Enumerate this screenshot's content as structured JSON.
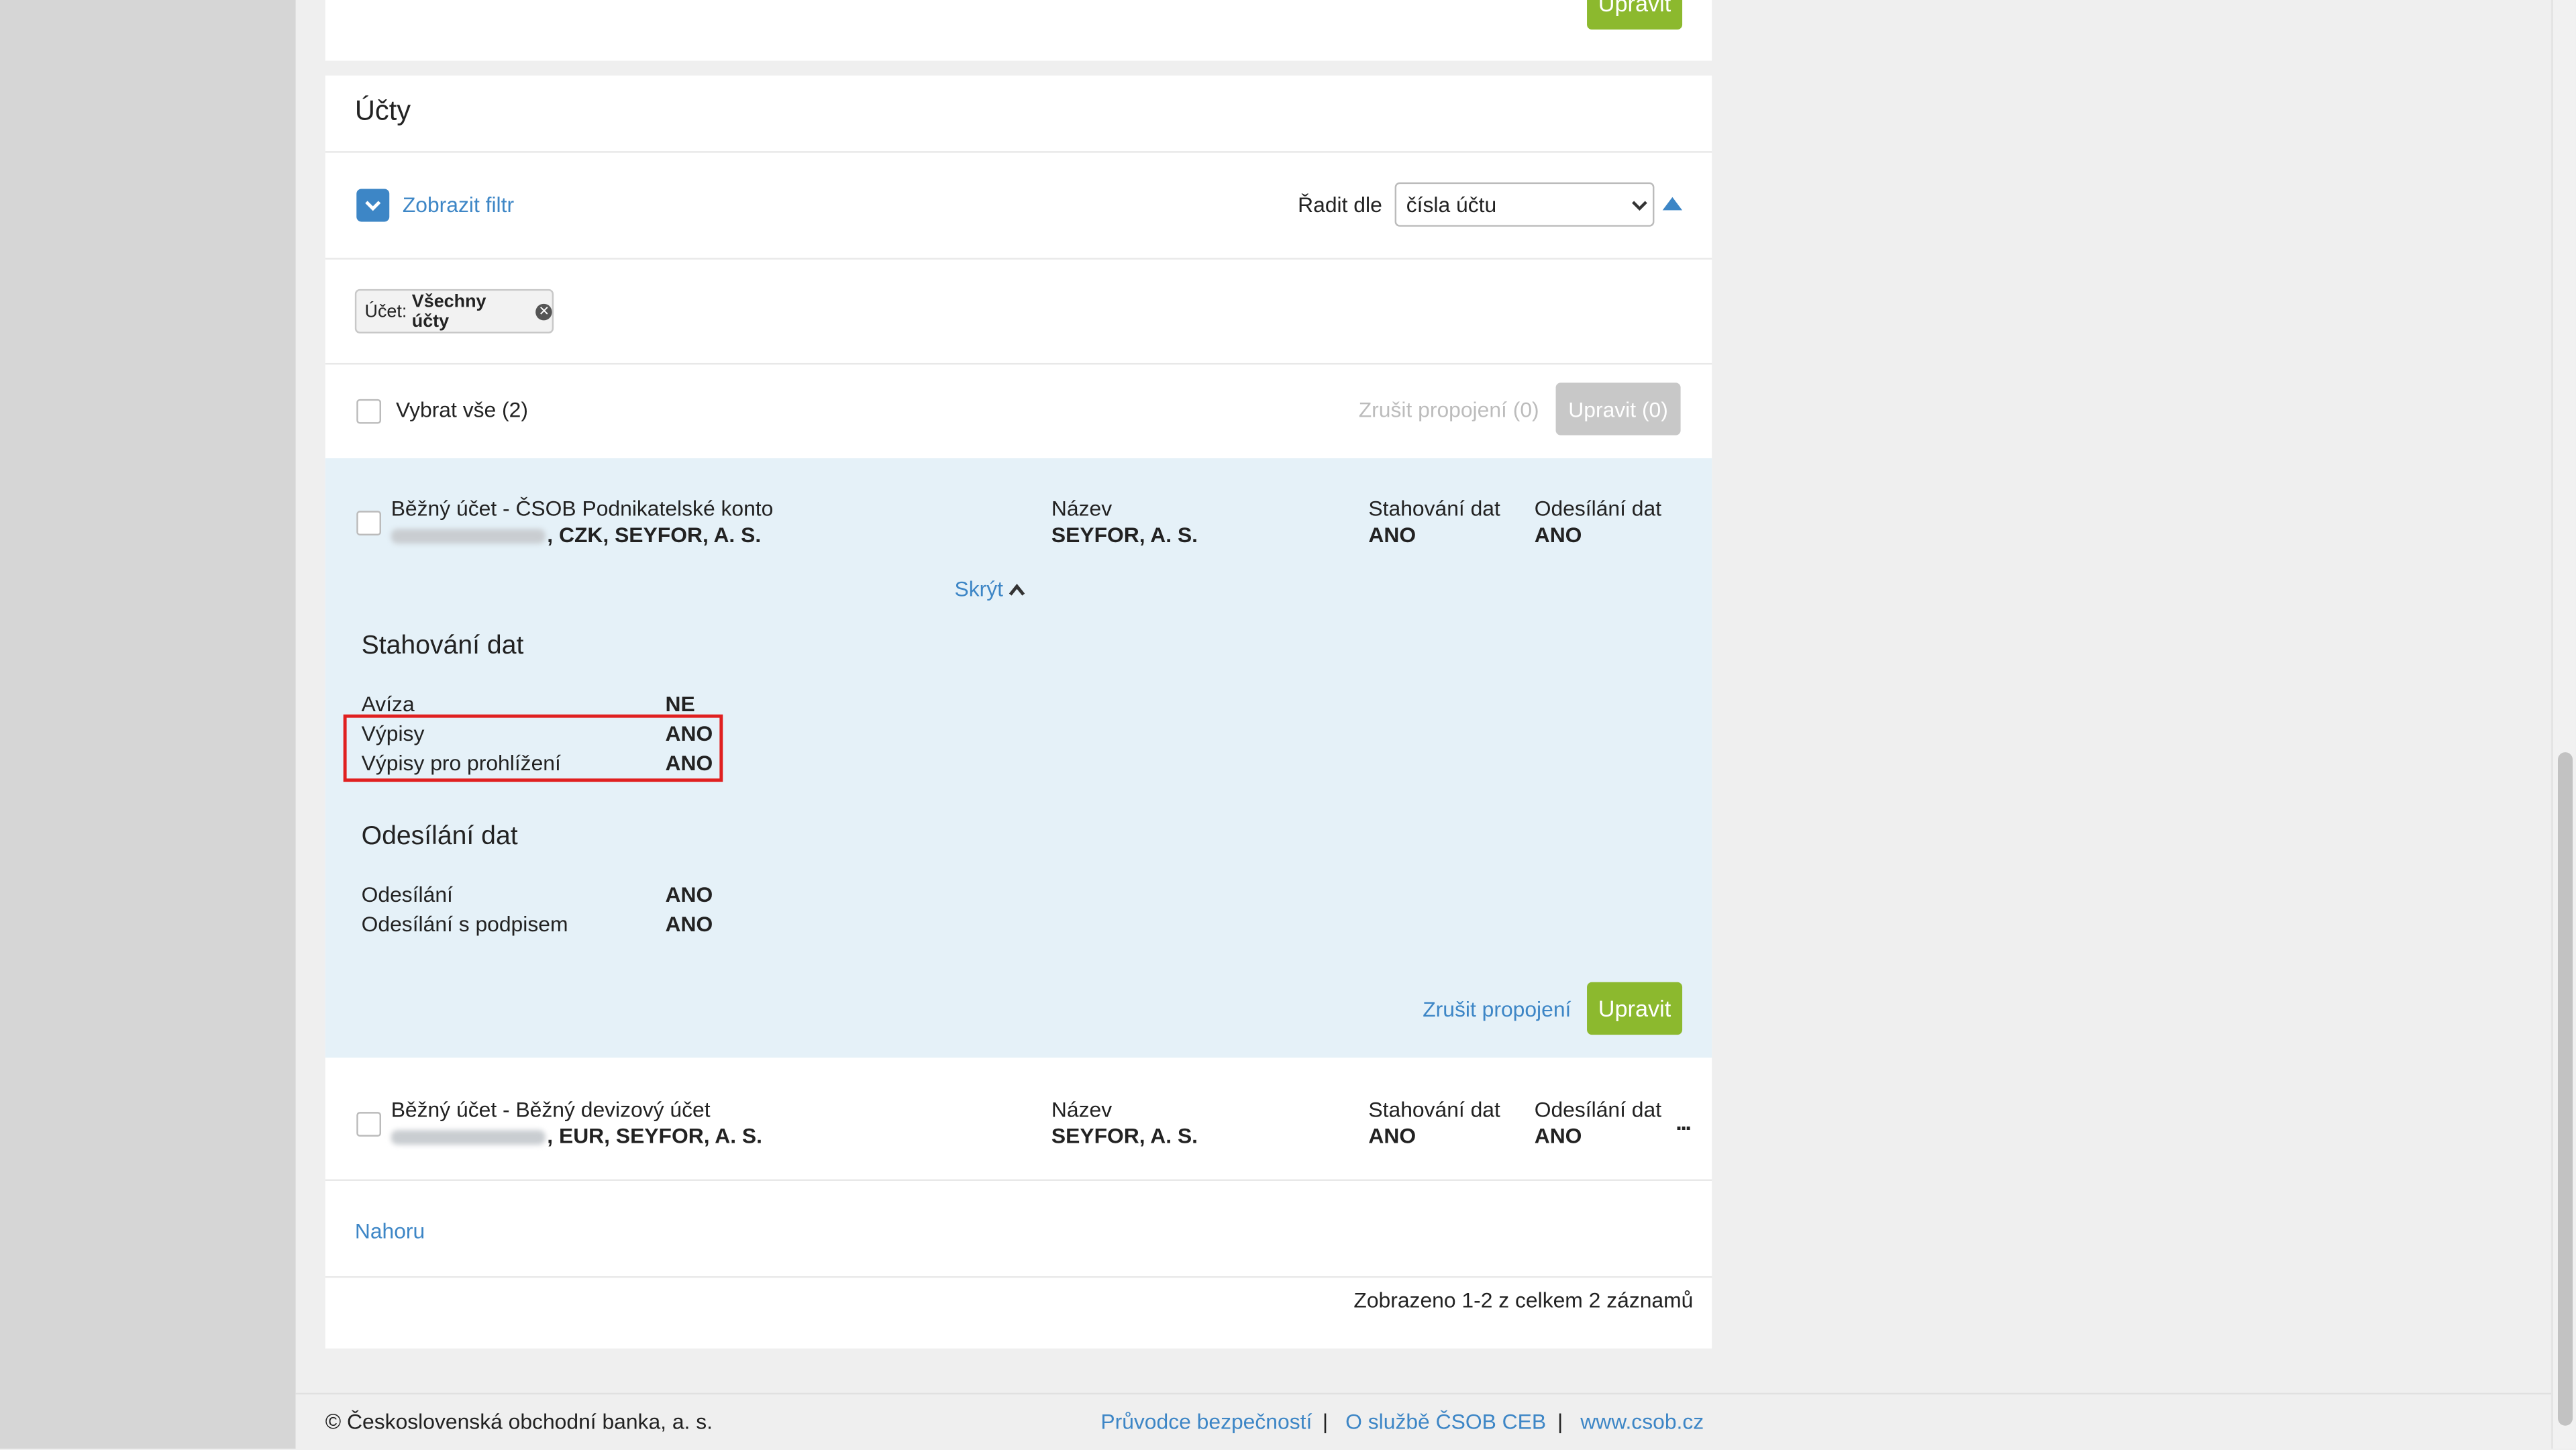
{
  "top": {
    "edit_label": "Upravit"
  },
  "section": {
    "title": "Účty"
  },
  "filter": {
    "toggle_label": "Zobrazit filtr"
  },
  "sort": {
    "label": "Řadit dle",
    "selected": "čísla účtu"
  },
  "chip": {
    "label": "Účet:",
    "value": "Všechny účty"
  },
  "bulk": {
    "select_all": "Vybrat vše (2)",
    "unlink": "Zrušit propojení (0)",
    "edit": "Upravit (0)"
  },
  "accounts": [
    {
      "title": "Běžný účet - ČSOB Podnikatelské konto",
      "suffix": ", CZK, SEYFOR, A. S.",
      "name_label": "Název",
      "name_value": "SEYFOR, A. S.",
      "download_label": "Stahování dat",
      "download_value": "ANO",
      "upload_label": "Odesílání dat",
      "upload_value": "ANO",
      "hide_label": "Skrýt",
      "details": {
        "download_title": "Stahování dat",
        "download_rows": [
          {
            "label": "Avíza",
            "value": "NE"
          },
          {
            "label": "Výpisy",
            "value": "ANO"
          },
          {
            "label": "Výpisy pro prohlížení",
            "value": "ANO"
          }
        ],
        "upload_title": "Odesílání dat",
        "upload_rows": [
          {
            "label": "Odesílání",
            "value": "ANO"
          },
          {
            "label": "Odesílání s podpisem",
            "value": "ANO"
          }
        ],
        "unlink": "Zrušit propojení",
        "edit": "Upravit"
      }
    },
    {
      "title": "Běžný účet - Běžný devizový účet",
      "suffix": ", EUR, SEYFOR, A. S.",
      "name_label": "Název",
      "name_value": "SEYFOR, A. S.",
      "download_label": "Stahování dat",
      "download_value": "ANO",
      "upload_label": "Odesílání dat",
      "upload_value": "ANO",
      "more": "..."
    }
  ],
  "back_to_top": "Nahoru",
  "pagination": "Zobrazeno 1-2 z celkem 2 záznamů",
  "footer": {
    "copyright": "© Československá obchodní banka, a. s.",
    "links": [
      "Průvodce bezpečností",
      "O službě ČSOB CEB",
      "www.csob.cz"
    ],
    "separator": "|"
  },
  "colors": {
    "accent": "#3d86c6",
    "primary_button": "#8cb92e",
    "row_highlight": "#e5f1f8",
    "annotation": "#e02020"
  }
}
